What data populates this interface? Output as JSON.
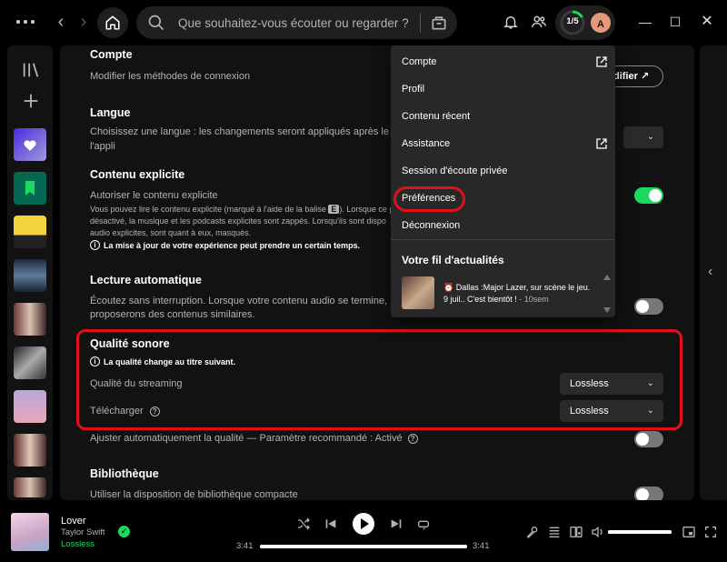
{
  "topbar": {
    "search_placeholder": "Que souhaitez-vous écouter ou regarder ?",
    "progress_label": "1/5",
    "avatar_initial": "A"
  },
  "settings": {
    "compte_title": "Compte",
    "compte_desc": "Modifier les méthodes de connexion",
    "compte_button": "difier",
    "langue_title": "Langue",
    "langue_desc_1": "Choisissez une langue : les changements seront appliqués après le rec",
    "langue_desc_2": "l'appli",
    "explicit_title": "Contenu explicite",
    "explicit_label": "Autoriser le contenu explicite",
    "explicit_small_1": "Vous pouvez lire le contenu explicite (marqué à l'aide de la balise",
    "explicit_badge": "E",
    "explicit_small_1b": "). Lorsque ce p",
    "explicit_small_2": "désactivé, la musique et les podcasts explicites sont zappés. Lorsqu'ils sont dispo",
    "explicit_small_3": "audio explicites, sont quant à eux, masqués.",
    "explicit_note": "La mise à jour de votre expérience peut prendre un certain temps.",
    "autoplay_title": "Lecture automatique",
    "autoplay_desc_1": "Écoutez sans interruption. Lorsque votre contenu audio se termine, no",
    "autoplay_desc_2": "proposerons des contenus similaires.",
    "quality_title": "Qualité sonore",
    "quality_note": "La qualité change au titre suivant.",
    "streaming_label": "Qualité du streaming",
    "streaming_value": "Lossless",
    "download_label": "Télécharger",
    "download_value": "Lossless",
    "auto_quality_label": "Ajuster automatiquement la qualité — Paramètre recommandé : Activé",
    "library_title": "Bibliothèque",
    "library_desc": "Utiliser la disposition de bibliothèque compacte"
  },
  "menu": {
    "items": [
      "Compte",
      "Profil",
      "Contenu récent",
      "Assistance",
      "Session d'écoute privée",
      "Préférences",
      "Déconnexion"
    ],
    "feed_title": "Votre fil d'actualités",
    "feed_line_1": "Dallas :Major Lazer, sur scène le jeu.",
    "feed_line_2": "9 juil.. C'est bientôt ! ·",
    "feed_time": "10sem"
  },
  "player": {
    "track": "Lover",
    "artist": "Taylor Swift",
    "quality": "Lossless",
    "elapsed": "3:41",
    "duration": "3:41",
    "progress": 1.0,
    "volume": 1.0
  },
  "colors": {
    "accent": "#1ed760",
    "highlight": "#e0101c",
    "background": "#121212"
  }
}
